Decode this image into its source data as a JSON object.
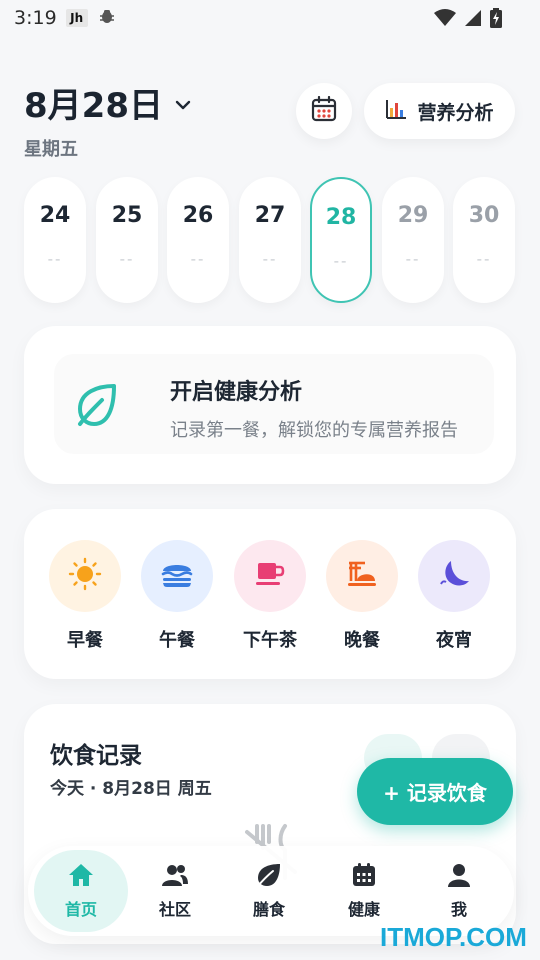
{
  "status_bar": {
    "time": "3:19",
    "app_icon_text": "Jh",
    "icons": [
      "bug-icon",
      "wifi-icon",
      "signal-icon",
      "battery-charging-icon"
    ]
  },
  "header": {
    "date": "8月28日",
    "weekday": "星期五",
    "analysis_label": "营养分析",
    "icons": [
      "chevron-down-icon",
      "calendar-icon",
      "bar-chart-icon"
    ]
  },
  "days": [
    {
      "num": "24",
      "value": "--",
      "state": "past"
    },
    {
      "num": "25",
      "value": "--",
      "state": "past"
    },
    {
      "num": "26",
      "value": "--",
      "state": "past"
    },
    {
      "num": "27",
      "value": "--",
      "state": "past"
    },
    {
      "num": "28",
      "value": "--",
      "state": "selected"
    },
    {
      "num": "29",
      "value": "--",
      "state": "future"
    },
    {
      "num": "30",
      "value": "--",
      "state": "future"
    }
  ],
  "health_card": {
    "title": "开启健康分析",
    "description": "记录第一餐，解锁您的专属营养报告",
    "icon": "leaf-icon"
  },
  "meals": [
    {
      "label": "早餐",
      "icon": "sun-icon",
      "bg": "#fff3e2"
    },
    {
      "label": "午餐",
      "icon": "burger-icon",
      "bg": "#e6efff"
    },
    {
      "label": "下午茶",
      "icon": "cup-icon",
      "bg": "#fde8ef"
    },
    {
      "label": "晚餐",
      "icon": "noodle-bowl-icon",
      "bg": "#ffeee4"
    },
    {
      "label": "夜宵",
      "icon": "moon-icon",
      "bg": "#ece9fb"
    }
  ],
  "record": {
    "title": "饮食记录",
    "subtitle": "今天 · 8月28日 周五"
  },
  "fab": {
    "label": "+ 记录饮食"
  },
  "nav": [
    {
      "label": "首页",
      "icon": "home-icon",
      "active": true
    },
    {
      "label": "社区",
      "icon": "community-icon",
      "active": false
    },
    {
      "label": "膳食",
      "icon": "diet-leaf-icon",
      "active": false
    },
    {
      "label": "健康",
      "icon": "health-calendar-icon",
      "active": false
    },
    {
      "label": "我",
      "icon": "person-icon",
      "active": false
    }
  ],
  "watermark": "ITMOP.COM",
  "colors": {
    "accent": "#1fb8a6",
    "background": "#f6f7f9",
    "text": "#1e2733"
  }
}
